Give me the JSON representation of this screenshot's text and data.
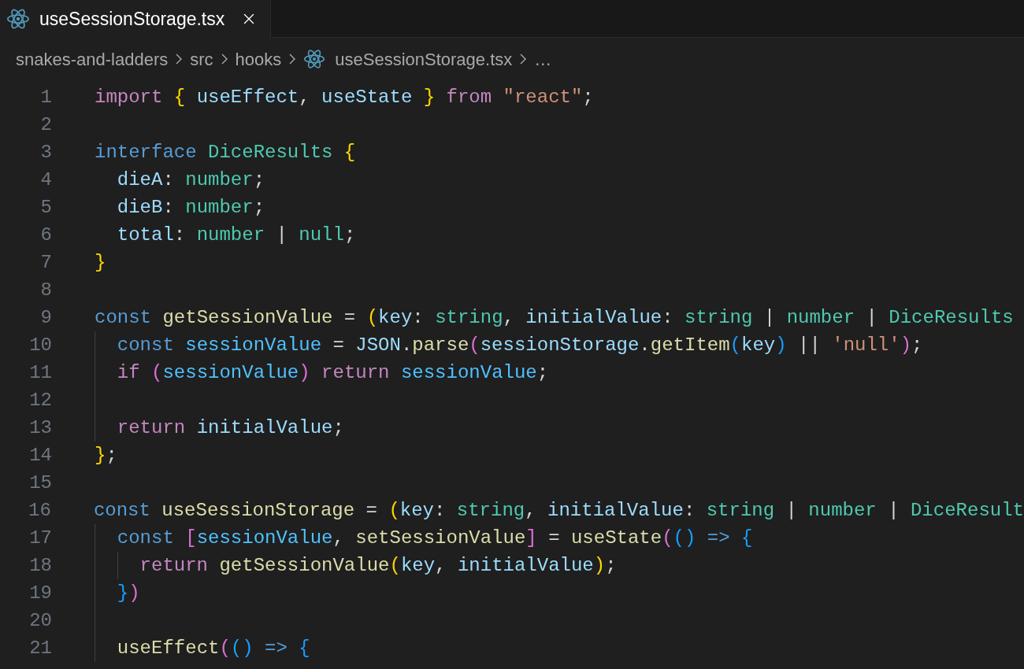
{
  "tabs": [
    {
      "label": "useSessionStorage.tsx",
      "selected": true
    }
  ],
  "breadcrumb": [
    {
      "kind": "folder",
      "label": "snakes-and-ladders"
    },
    {
      "kind": "folder",
      "label": "src"
    },
    {
      "kind": "folder",
      "label": "hooks"
    },
    {
      "kind": "file",
      "label": "useSessionStorage.tsx"
    },
    {
      "kind": "more",
      "label": "…"
    }
  ],
  "lines": [
    {
      "number": "1",
      "guide": false,
      "inner_guide": false,
      "tokens": [
        {
          "kind": "kw",
          "text": "import "
        },
        {
          "kind": "b1",
          "text": "{ "
        },
        {
          "kind": "var",
          "text": "useEffect"
        },
        {
          "kind": "p",
          "text": ", "
        },
        {
          "kind": "var",
          "text": "useState "
        },
        {
          "kind": "b1",
          "text": "} "
        },
        {
          "kind": "kw",
          "text": "from "
        },
        {
          "kind": "str",
          "text": "\"react\""
        },
        {
          "kind": "p",
          "text": ";"
        }
      ]
    },
    {
      "number": "2",
      "guide": false,
      "inner_guide": false
    },
    {
      "number": "3",
      "guide": false,
      "inner_guide": false,
      "tokens": [
        {
          "kind": "st",
          "text": "interface "
        },
        {
          "kind": "type",
          "text": "DiceResults "
        },
        {
          "kind": "b1",
          "text": "{"
        }
      ]
    },
    {
      "number": "4",
      "guide": false,
      "inner_guide": false,
      "tokens": [
        {
          "kind": "var",
          "text": "  dieA"
        },
        {
          "kind": "p",
          "text": ": "
        },
        {
          "kind": "type",
          "text": "number"
        },
        {
          "kind": "p",
          "text": ";"
        }
      ]
    },
    {
      "number": "5",
      "guide": false,
      "inner_guide": false,
      "tokens": [
        {
          "kind": "var",
          "text": "  dieB"
        },
        {
          "kind": "p",
          "text": ": "
        },
        {
          "kind": "type",
          "text": "number"
        },
        {
          "kind": "p",
          "text": ";"
        }
      ]
    },
    {
      "number": "6",
      "guide": false,
      "inner_guide": false,
      "tokens": [
        {
          "kind": "var",
          "text": "  total"
        },
        {
          "kind": "p",
          "text": ": "
        },
        {
          "kind": "type",
          "text": "number"
        },
        {
          "kind": "p",
          "text": " | "
        },
        {
          "kind": "type",
          "text": "null"
        },
        {
          "kind": "p",
          "text": ";"
        }
      ]
    },
    {
      "number": "7",
      "guide": false,
      "inner_guide": false,
      "tokens": [
        {
          "kind": "b1",
          "text": "}"
        }
      ]
    },
    {
      "number": "8",
      "guide": false,
      "inner_guide": false
    },
    {
      "number": "9",
      "guide": false,
      "inner_guide": false,
      "tokens": [
        {
          "kind": "st",
          "text": "const "
        },
        {
          "kind": "fn",
          "text": "getSessionValue"
        },
        {
          "kind": "p",
          "text": " = "
        },
        {
          "kind": "b1",
          "text": "("
        },
        {
          "kind": "var",
          "text": "key"
        },
        {
          "kind": "p",
          "text": ": "
        },
        {
          "kind": "type",
          "text": "string"
        },
        {
          "kind": "p",
          "text": ", "
        },
        {
          "kind": "var",
          "text": "initialValue"
        },
        {
          "kind": "p",
          "text": ": "
        },
        {
          "kind": "type",
          "text": "string"
        },
        {
          "kind": "p",
          "text": " | "
        },
        {
          "kind": "type",
          "text": "number"
        },
        {
          "kind": "p",
          "text": " | "
        },
        {
          "kind": "type",
          "text": "DiceResults"
        }
      ]
    },
    {
      "number": "10",
      "guide": true,
      "inner_guide": false,
      "tokens": [
        {
          "kind": "st",
          "text": "  const "
        },
        {
          "kind": "cvar",
          "text": "sessionValue"
        },
        {
          "kind": "p",
          "text": " = "
        },
        {
          "kind": "var",
          "text": "JSON"
        },
        {
          "kind": "p",
          "text": "."
        },
        {
          "kind": "fn",
          "text": "parse"
        },
        {
          "kind": "b2",
          "text": "("
        },
        {
          "kind": "var",
          "text": "sessionStorage"
        },
        {
          "kind": "p",
          "text": "."
        },
        {
          "kind": "fn",
          "text": "getItem"
        },
        {
          "kind": "b3",
          "text": "("
        },
        {
          "kind": "var",
          "text": "key"
        },
        {
          "kind": "b3",
          "text": ")"
        },
        {
          "kind": "p",
          "text": " || "
        },
        {
          "kind": "str",
          "text": "'null'"
        },
        {
          "kind": "b2",
          "text": ")"
        },
        {
          "kind": "p",
          "text": ";"
        }
      ]
    },
    {
      "number": "11",
      "guide": true,
      "inner_guide": false,
      "tokens": [
        {
          "kind": "kw",
          "text": "  if "
        },
        {
          "kind": "b2",
          "text": "("
        },
        {
          "kind": "cvar",
          "text": "sessionValue"
        },
        {
          "kind": "b2",
          "text": ") "
        },
        {
          "kind": "kw",
          "text": "return "
        },
        {
          "kind": "cvar",
          "text": "sessionValue"
        },
        {
          "kind": "p",
          "text": ";"
        }
      ]
    },
    {
      "number": "12",
      "guide": true,
      "inner_guide": false
    },
    {
      "number": "13",
      "guide": true,
      "inner_guide": false,
      "tokens": [
        {
          "kind": "kw",
          "text": "  return "
        },
        {
          "kind": "var",
          "text": "initialValue"
        },
        {
          "kind": "p",
          "text": ";"
        }
      ]
    },
    {
      "number": "14",
      "guide": false,
      "inner_guide": false,
      "tokens": [
        {
          "kind": "b1",
          "text": "}"
        },
        {
          "kind": "p",
          "text": ";"
        }
      ]
    },
    {
      "number": "15",
      "guide": false,
      "inner_guide": false
    },
    {
      "number": "16",
      "guide": false,
      "inner_guide": false,
      "tokens": [
        {
          "kind": "st",
          "text": "const "
        },
        {
          "kind": "fn",
          "text": "useSessionStorage"
        },
        {
          "kind": "p",
          "text": " = "
        },
        {
          "kind": "b1",
          "text": "("
        },
        {
          "kind": "var",
          "text": "key"
        },
        {
          "kind": "p",
          "text": ": "
        },
        {
          "kind": "type",
          "text": "string"
        },
        {
          "kind": "p",
          "text": ", "
        },
        {
          "kind": "var",
          "text": "initialValue"
        },
        {
          "kind": "p",
          "text": ": "
        },
        {
          "kind": "type",
          "text": "string"
        },
        {
          "kind": "p",
          "text": " | "
        },
        {
          "kind": "type",
          "text": "number"
        },
        {
          "kind": "p",
          "text": " | "
        },
        {
          "kind": "type",
          "text": "DiceResult"
        }
      ]
    },
    {
      "number": "17",
      "guide": true,
      "inner_guide": false,
      "tokens": [
        {
          "kind": "st",
          "text": "  const "
        },
        {
          "kind": "b2",
          "text": "["
        },
        {
          "kind": "cvar",
          "text": "sessionValue"
        },
        {
          "kind": "p",
          "text": ", "
        },
        {
          "kind": "fn",
          "text": "setSessionValue"
        },
        {
          "kind": "b2",
          "text": "]"
        },
        {
          "kind": "p",
          "text": " = "
        },
        {
          "kind": "fn",
          "text": "useState"
        },
        {
          "kind": "b2",
          "text": "("
        },
        {
          "kind": "b3",
          "text": "() "
        },
        {
          "kind": "st",
          "text": "=> "
        },
        {
          "kind": "b3",
          "text": "{"
        }
      ]
    },
    {
      "number": "18",
      "guide": true,
      "inner_guide": true,
      "tokens": [
        {
          "kind": "kw",
          "text": "    return "
        },
        {
          "kind": "fn",
          "text": "getSessionValue"
        },
        {
          "kind": "b1",
          "text": "("
        },
        {
          "kind": "var",
          "text": "key"
        },
        {
          "kind": "p",
          "text": ", "
        },
        {
          "kind": "var",
          "text": "initialValue"
        },
        {
          "kind": "b1",
          "text": ")"
        },
        {
          "kind": "p",
          "text": ";"
        }
      ]
    },
    {
      "number": "19",
      "guide": true,
      "inner_guide": false,
      "tokens": [
        {
          "kind": "b3",
          "text": "  }"
        },
        {
          "kind": "b2",
          "text": ")"
        }
      ]
    },
    {
      "number": "20",
      "guide": true,
      "inner_guide": false
    },
    {
      "number": "21",
      "guide": true,
      "inner_guide": false,
      "tokens": [
        {
          "kind": "fn",
          "text": "  useEffect"
        },
        {
          "kind": "b2",
          "text": "("
        },
        {
          "kind": "b3",
          "text": "() "
        },
        {
          "kind": "st",
          "text": "=> "
        },
        {
          "kind": "b3",
          "text": "{"
        }
      ]
    }
  ]
}
